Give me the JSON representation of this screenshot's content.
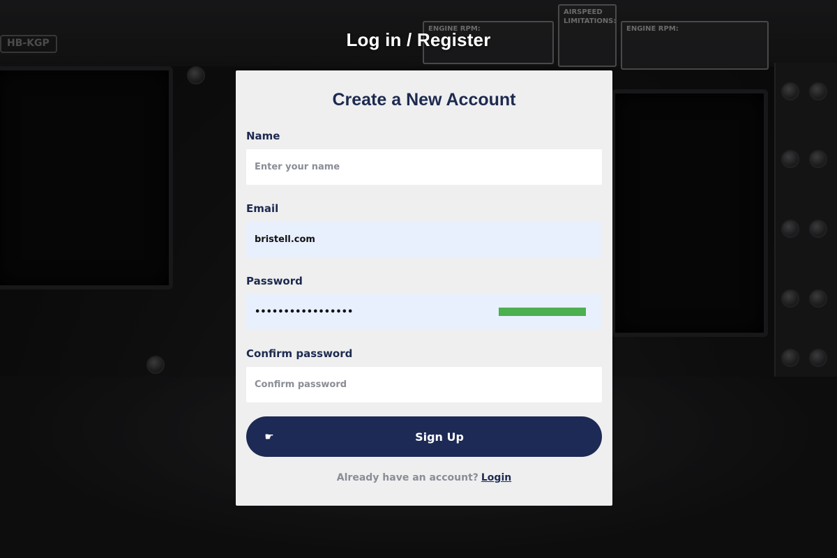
{
  "page": {
    "title": "Log in / Register"
  },
  "background": {
    "registration_mark": "HB-KGP",
    "placard_engine_rpm_left": "ENGINE RPM:",
    "placard_airspeed": "AIRSPEED LIMITATIONS:",
    "placard_engine_rpm_right": "ENGINE RPM:"
  },
  "form": {
    "heading": "Create a New Account",
    "name": {
      "label": "Name",
      "placeholder": "Enter your name",
      "value": ""
    },
    "email": {
      "label": "Email",
      "placeholder": "",
      "value": "bristell.com"
    },
    "password": {
      "label": "Password",
      "value": "•••••••••••••••••",
      "strength_fraction": 1.0,
      "strength_color": "#4caf50"
    },
    "confirm_password": {
      "label": "Confirm password",
      "placeholder": "Confirm password",
      "value": ""
    },
    "submit": {
      "label": "Sign Up",
      "icon": "pointing-hand-icon"
    },
    "footer": {
      "prompt": "Already have an account?",
      "link_label": "Login"
    }
  },
  "colors": {
    "primary": "#1d2a55",
    "heading": "#1d2a4f",
    "card_bg": "#efeff0",
    "autofill_bg": "#e8f0fe",
    "muted_text": "#8a8d96"
  }
}
